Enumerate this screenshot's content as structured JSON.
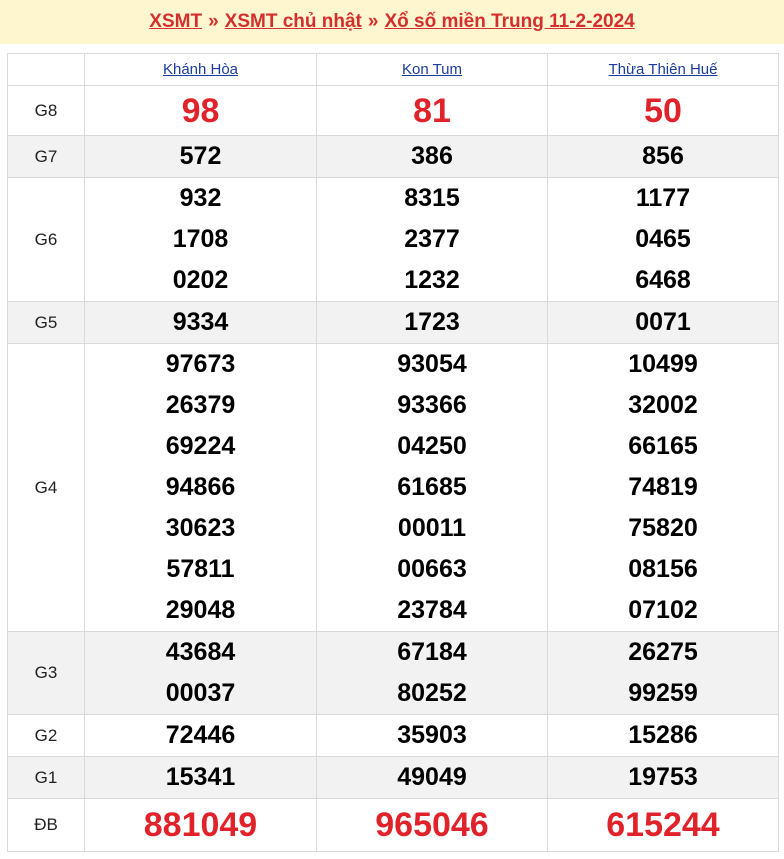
{
  "breadcrumb": {
    "items": [
      "XSMT",
      "XSMT chủ nhật",
      "Xổ số miền Trung 11-2-2024"
    ],
    "separator": "»"
  },
  "table": {
    "columns": [
      "Khánh Hòa",
      "Kon Tum",
      "Thừa Thiên Huế"
    ],
    "prizes": [
      {
        "label": "G8",
        "values": [
          [
            "98"
          ],
          [
            "81"
          ],
          [
            "50"
          ]
        ]
      },
      {
        "label": "G7",
        "values": [
          [
            "572"
          ],
          [
            "386"
          ],
          [
            "856"
          ]
        ]
      },
      {
        "label": "G6",
        "values": [
          [
            "932",
            "1708",
            "0202"
          ],
          [
            "8315",
            "2377",
            "1232"
          ],
          [
            "1177",
            "0465",
            "6468"
          ]
        ]
      },
      {
        "label": "G5",
        "values": [
          [
            "9334"
          ],
          [
            "1723"
          ],
          [
            "0071"
          ]
        ]
      },
      {
        "label": "G4",
        "values": [
          [
            "97673",
            "26379",
            "69224",
            "94866",
            "30623",
            "57811",
            "29048"
          ],
          [
            "93054",
            "93366",
            "04250",
            "61685",
            "00011",
            "00663",
            "23784"
          ],
          [
            "10499",
            "32002",
            "66165",
            "74819",
            "75820",
            "08156",
            "07102"
          ]
        ]
      },
      {
        "label": "G3",
        "values": [
          [
            "43684",
            "00037"
          ],
          [
            "67184",
            "80252"
          ],
          [
            "26275",
            "99259"
          ]
        ]
      },
      {
        "label": "G2",
        "values": [
          [
            "72446"
          ],
          [
            "35903"
          ],
          [
            "15286"
          ]
        ]
      },
      {
        "label": "G1",
        "values": [
          [
            "15341"
          ],
          [
            "49049"
          ],
          [
            "19753"
          ]
        ]
      },
      {
        "label": "ĐB",
        "values": [
          [
            "881049"
          ],
          [
            "965046"
          ],
          [
            "615244"
          ]
        ]
      }
    ]
  }
}
